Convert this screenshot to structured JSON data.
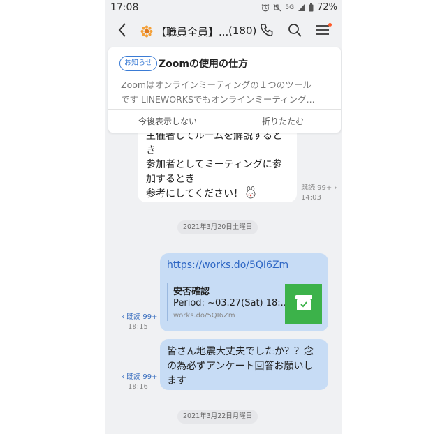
{
  "status_bar": {
    "time": "17:08",
    "network": "5G",
    "battery": "72%"
  },
  "header": {
    "title": "【職員全員】...",
    "member_count": "(180)"
  },
  "notice": {
    "badge": "お知らせ",
    "title": "Zoomの使用の仕方",
    "body_lines": [
      "Zoomはオンラインミーティングの１つのツール",
      "です  LINEWORKSでもオンラインミーティング..."
    ],
    "hide_button": "今後表示しない",
    "fold_button": "折りたたむ"
  },
  "messages": {
    "incoming_lines": [
      "主催者してルームを解説すると",
      "き",
      "参加者としてミーティングに参",
      "加するとき",
      "参考にしてください！"
    ],
    "incoming_read": "既読 99+ ›",
    "incoming_time": "14:03",
    "date1": "2021年3月20日土曜日",
    "link_url": "https://works.do/5QI6Zm",
    "link_preview": {
      "title": "安否確認",
      "description": "Period: ~03.27(Sat) 18:...",
      "domain": "works.do/5QI6Zm"
    },
    "link_read": "‹ 既読 99+",
    "link_time": "18:15",
    "text_lines": [
      "皆さん地震大丈夫でしたか？？念",
      "の為必ずアンケート回答お願いし",
      "ます"
    ],
    "text_read": "‹ 既読 99+",
    "text_time": "18:16",
    "date2": "2021年3月22日月曜日"
  },
  "icons": {
    "back": "chevron-left-icon",
    "call": "phone-icon",
    "search": "search-icon",
    "menu": "hamburger-menu-icon",
    "group": "sun-flower-icon",
    "preview": "box-check-icon"
  },
  "colors": {
    "chat_background": "#f0f1f3",
    "outgoing_bubble": "#c7dcf5",
    "link": "#2d66c4",
    "notice_accent": "#3a7bd5",
    "preview_thumb": "#3cb24a",
    "menu_badge": "#ff5a28"
  }
}
